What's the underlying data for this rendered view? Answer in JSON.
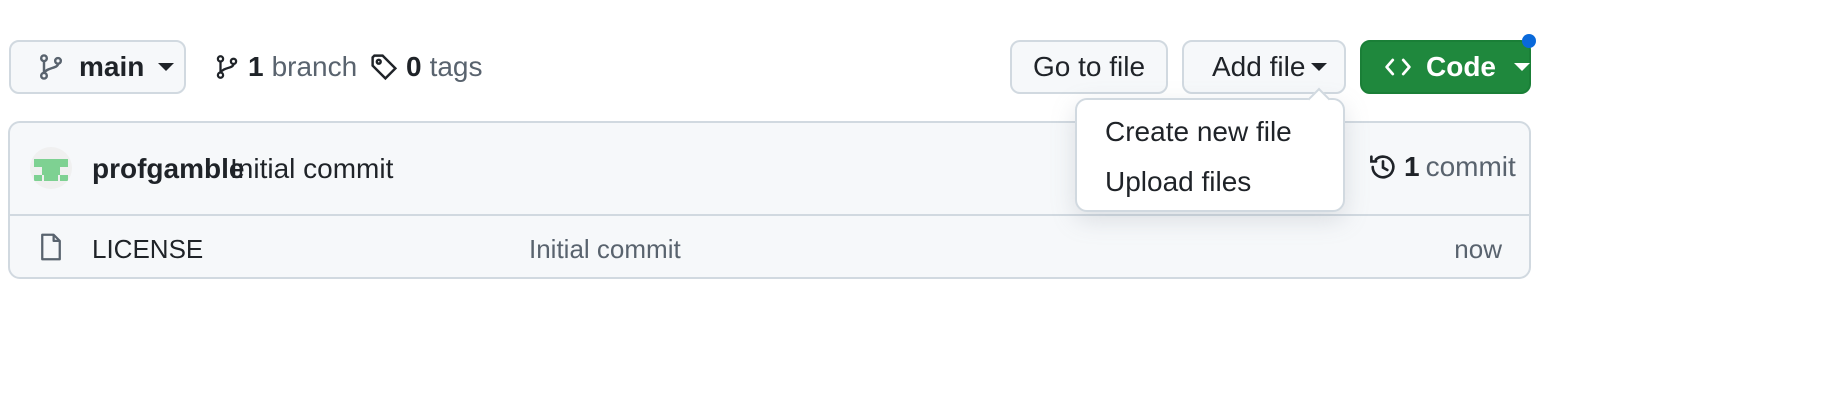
{
  "toolbar": {
    "branch_selector": {
      "label": "main",
      "icon": "git-branch-icon"
    },
    "branches": {
      "count": "1",
      "label": "branch"
    },
    "tags": {
      "count": "0",
      "label": "tags"
    },
    "go_to_file": "Go to file",
    "add_file": "Add file",
    "code": "Code"
  },
  "add_file_menu": {
    "items": [
      {
        "label": "Create new file"
      },
      {
        "label": "Upload files"
      }
    ]
  },
  "latest_commit": {
    "author": "profgamble",
    "message": "Initial commit",
    "commit_count": "1",
    "commit_label": "commit"
  },
  "files": [
    {
      "name": "LICENSE",
      "message": "Initial commit",
      "age": "now",
      "icon": "file-icon"
    }
  ],
  "colors": {
    "code_button": "#1f883d",
    "notification_dot": "#0969da",
    "border": "#d1d9e0",
    "muted_text": "#59636e"
  }
}
